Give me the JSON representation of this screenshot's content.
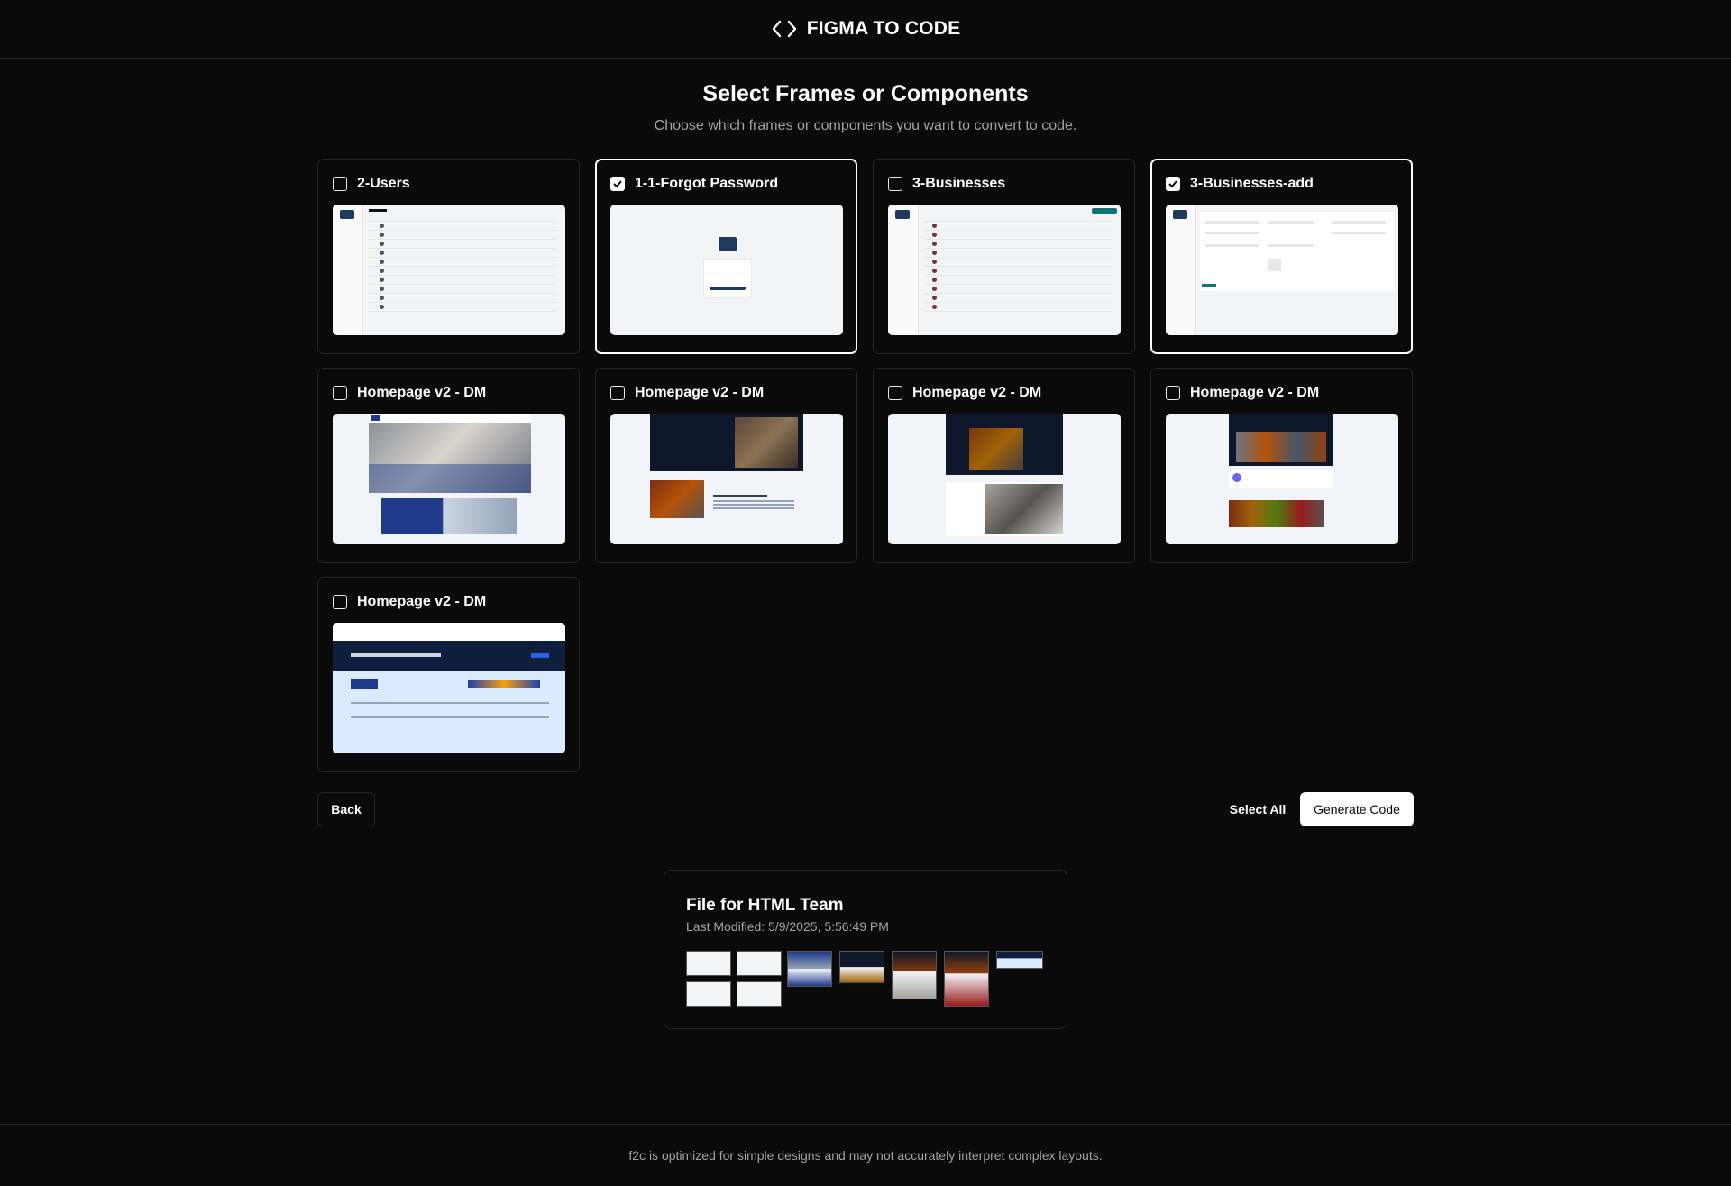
{
  "header": {
    "app_title": "FIGMA TO CODE",
    "logo_icon": "code-brackets-icon"
  },
  "page": {
    "title": "Select Frames or Components",
    "subtitle": "Choose which frames or components you want to convert to code."
  },
  "frames": [
    {
      "label": "2-Users",
      "selected": false
    },
    {
      "label": "1-1-Forgot Password",
      "selected": true
    },
    {
      "label": "3-Businesses",
      "selected": false
    },
    {
      "label": "3-Businesses-add",
      "selected": true
    },
    {
      "label": "Homepage v2 - DM",
      "selected": false
    },
    {
      "label": "Homepage v2 - DM",
      "selected": false
    },
    {
      "label": "Homepage v2 - DM",
      "selected": false
    },
    {
      "label": "Homepage v2 - DM",
      "selected": false
    },
    {
      "label": "Homepage v2 - DM",
      "selected": false
    }
  ],
  "actions": {
    "back_label": "Back",
    "select_all_label": "Select All",
    "generate_label": "Generate Code"
  },
  "file": {
    "name": "File for HTML Team",
    "last_modified": "Last Modified: 5/9/2025, 5:56:49 PM"
  },
  "footer": {
    "note": "f2c is optimized for simple designs and may not accurately interpret complex layouts."
  },
  "colors": {
    "background": "#0a0a0a",
    "border": "#262626",
    "muted_text": "#a3a3a3",
    "primary_button": "#ffffff"
  }
}
